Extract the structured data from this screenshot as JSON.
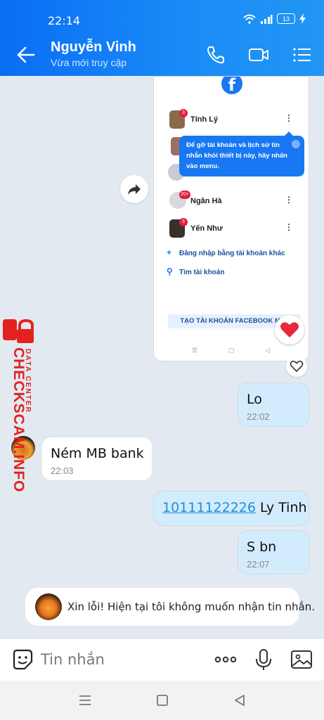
{
  "status_bar": {
    "time": "22:14",
    "battery": "13"
  },
  "header": {
    "contact_name": "Nguyễn Vinh",
    "contact_status": "Vừa mới truy cập"
  },
  "screenshot": {
    "accounts": [
      {
        "name": "Tính Lý",
        "badge": "3"
      },
      {
        "name": "Ngân Hà",
        "badge": "20+"
      },
      {
        "name": "Yến Như",
        "badge": "3"
      }
    ],
    "tooltip": "Để gỡ tài khoản và lịch sử tin nhắn khỏi thiết bị này, hãy nhấn vào menu.",
    "login_other": "Đăng nhập bằng tài khoản khác",
    "find_account": "Tìm tài khoản",
    "create_account": "TẠO TÀI KHOẢN FACEBOOK MỚI"
  },
  "messages": [
    {
      "direction": "out",
      "text": "Lo",
      "time": "22:02"
    },
    {
      "direction": "in",
      "text": "Ném MB bank",
      "time": "22:03"
    },
    {
      "direction": "out",
      "link": "10111122226",
      "text": " Ly Tinh"
    },
    {
      "direction": "out",
      "text": "S bn",
      "time": "22:07"
    }
  ],
  "notice": {
    "text": "Xin lỗi! Hiện tại tôi không muốn nhận tin nhắn."
  },
  "watermark": {
    "big": "CHECKSCAM.INFO",
    "small": "DATA CENTER"
  },
  "input": {
    "placeholder": "Tin nhắn"
  },
  "colors": {
    "header_blue": "#0a6ef5",
    "bubble_out": "#d3ecfd",
    "watermark_red": "#e3221f"
  }
}
